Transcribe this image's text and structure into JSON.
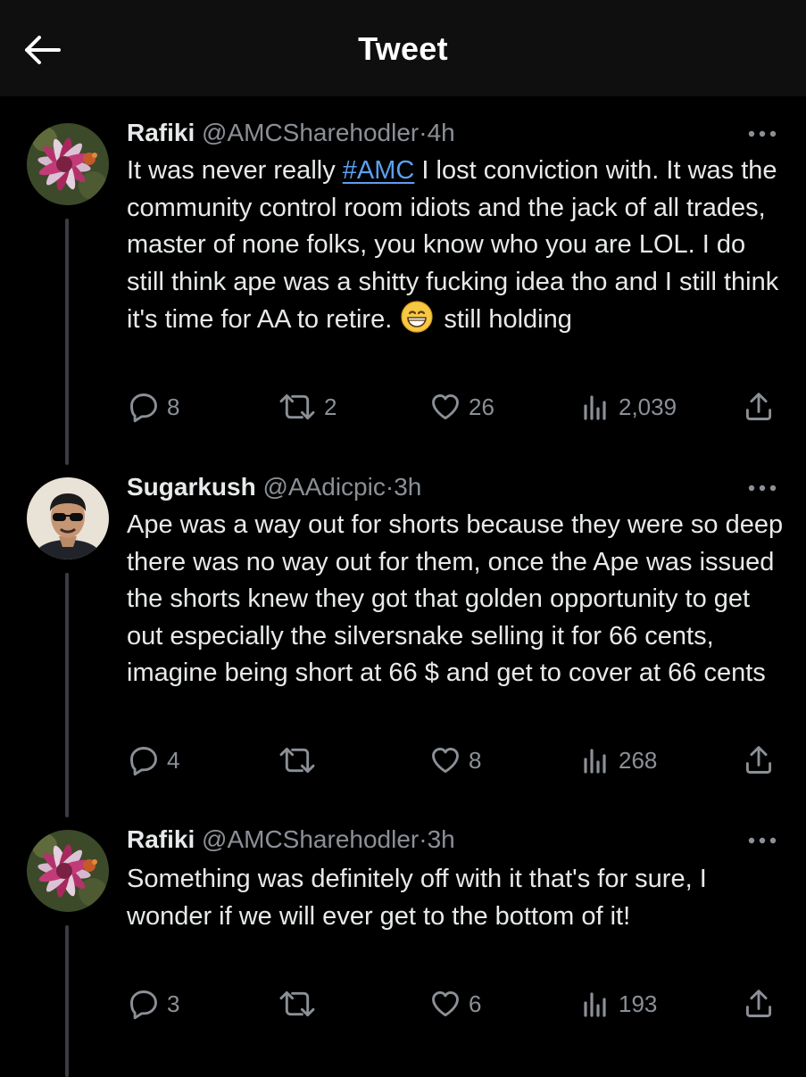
{
  "header": {
    "title": "Tweet",
    "back_icon": "arrow-left-icon"
  },
  "tweets": [
    {
      "name": "Rafiki",
      "handle": "@AMCSharehodler",
      "sep": "·",
      "time": "4h",
      "text_part1": "It was never really ",
      "hashtag": "#AMC",
      "text_part2": " I lost conviction with. It was the community control room idiots and the jack of all trades, master of none folks, you know who you are LOL. I do still think ape was a shitty fucking idea tho and I still think it's time for AA to retire. ",
      "emoji": "grinning-face-emoji",
      "text_part3": " still holding",
      "replies": "8",
      "retweets": "2",
      "likes": "26",
      "views": "2,039"
    },
    {
      "name": "Sugarkush",
      "handle": "@AAdicpic",
      "sep": "·",
      "time": "3h",
      "text": "Ape was a way out for shorts because they were so deep there was no way out for them, once the Ape was issued the shorts knew they got that golden opportunity to get out especially the silversnake selling it for 66 cents, imagine being short at 66 $ and get to cover at 66 cents",
      "replies": "4",
      "retweets": "",
      "likes": "8",
      "views": "268"
    },
    {
      "name": "Rafiki",
      "handle": "@AMCSharehodler",
      "sep": "·",
      "time": "3h",
      "text": "Something was definitely off with it that's for sure, I wonder if we will ever get to the bottom of it!",
      "replies": "3",
      "retweets": "",
      "likes": "6",
      "views": "193"
    }
  ],
  "colors": {
    "background": "#000000",
    "header_bg": "#0f0f0f",
    "text": "#e7e9ea",
    "muted": "#8b9096",
    "link": "#5c9ff0",
    "thread_line": "#3a3d40"
  }
}
